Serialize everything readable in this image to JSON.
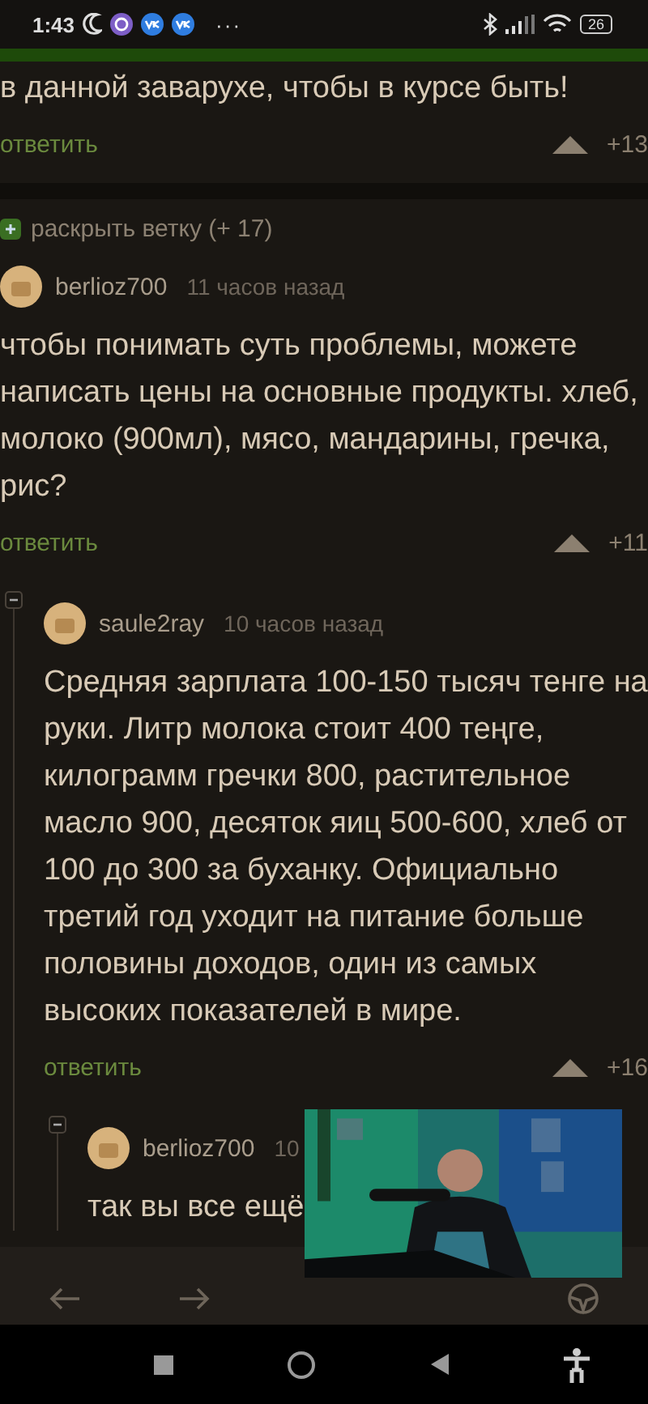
{
  "status_bar": {
    "time": "1:43",
    "more": "···",
    "battery": "26"
  },
  "top_comment": {
    "text": "в данной заварухе, чтобы в курсе быть!",
    "reply": "ответить",
    "score": "+13"
  },
  "expand_branch": {
    "label": "раскрыть ветку (+ 17)"
  },
  "comments": [
    {
      "author": "berlioz700",
      "time": "11 часов назад",
      "text": "чтобы понимать суть проблемы, можете написать цены на основные продукты. хлеб, молоко (900мл), мясо, мандарины, гречка, рис?",
      "reply": "ответить",
      "score": "+11",
      "children": [
        {
          "author": "saule2ray",
          "time": "10 часов назад",
          "text": "Средняя зарплата 100-150 тысяч тенге на руки. Литр молока стоит 400 теңге, килограмм гречки 800, растительное масло 900, десяток яиц 500-600, хлеб от 100 до 300 за буханку. Официально третий год уходит на питание больше половины доходов, один из самых высоких показателей в мире.",
          "reply": "ответить",
          "score": "+16",
          "children": [
            {
              "author": "berlioz700",
              "time": "10",
              "text": "так вы все ещё"
            }
          ]
        }
      ]
    }
  ]
}
